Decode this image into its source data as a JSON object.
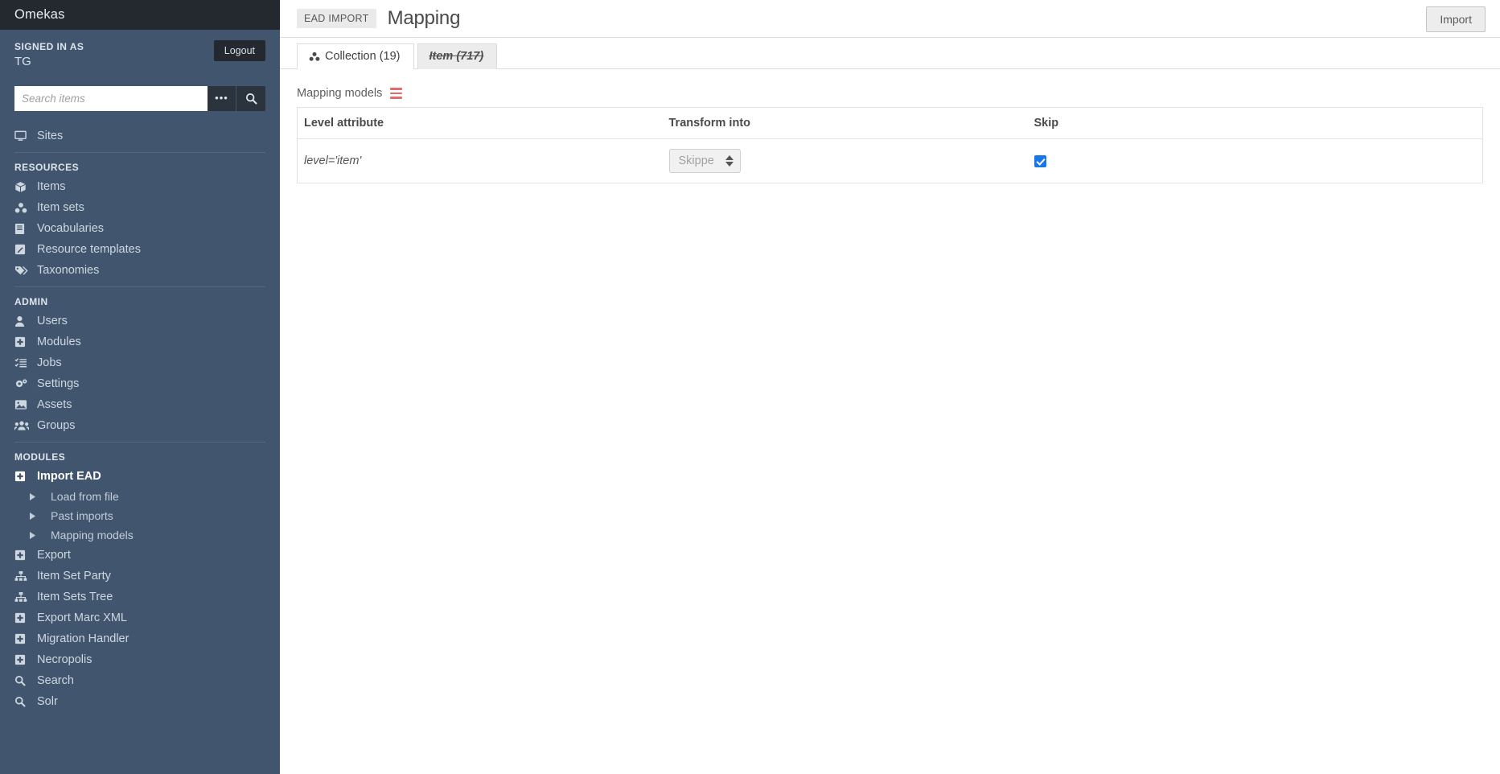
{
  "sidebar": {
    "brand": "Omekas",
    "signed_in_label": "SIGNED IN AS",
    "user": "TG",
    "logout_label": "Logout",
    "search_placeholder": "Search items",
    "search_value": "",
    "top_items": [
      {
        "label": "Sites",
        "icon": "desktop-icon"
      }
    ],
    "sections": [
      {
        "heading": "RESOURCES",
        "items": [
          {
            "label": "Items",
            "icon": "cube-icon"
          },
          {
            "label": "Item sets",
            "icon": "item-sets-icon"
          },
          {
            "label": "Vocabularies",
            "icon": "book-icon"
          },
          {
            "label": "Resource templates",
            "icon": "pencil-square-icon"
          },
          {
            "label": "Taxonomies",
            "icon": "tags-icon"
          }
        ]
      },
      {
        "heading": "ADMIN",
        "items": [
          {
            "label": "Users",
            "icon": "user-icon"
          },
          {
            "label": "Modules",
            "icon": "puzzle-icon"
          },
          {
            "label": "Jobs",
            "icon": "tasks-icon"
          },
          {
            "label": "Settings",
            "icon": "cogs-icon"
          },
          {
            "label": "Assets",
            "icon": "image-icon"
          },
          {
            "label": "Groups",
            "icon": "users-icon"
          }
        ]
      },
      {
        "heading": "MODULES",
        "items": [
          {
            "label": "Import EAD",
            "icon": "puzzle-icon",
            "active": true,
            "children": [
              {
                "label": "Load from file",
                "icon": "caret-right-icon"
              },
              {
                "label": "Past imports",
                "icon": "caret-right-icon"
              },
              {
                "label": "Mapping models",
                "icon": "caret-right-icon"
              }
            ]
          },
          {
            "label": "Export",
            "icon": "puzzle-icon"
          },
          {
            "label": "Item Set Party",
            "icon": "sitemap-icon"
          },
          {
            "label": "Item Sets Tree",
            "icon": "sitemap-icon"
          },
          {
            "label": "Export Marc XML",
            "icon": "puzzle-icon"
          },
          {
            "label": "Migration Handler",
            "icon": "puzzle-icon"
          },
          {
            "label": "Necropolis",
            "icon": "puzzle-icon"
          },
          {
            "label": "Search",
            "icon": "search-icon"
          },
          {
            "label": "Solr",
            "icon": "search-icon"
          }
        ]
      }
    ]
  },
  "header": {
    "breadcrumb": "EAD IMPORT",
    "title": "Mapping",
    "import_label": "Import"
  },
  "tabs": [
    {
      "label": "Collection (19)",
      "icon": "item-sets-icon",
      "active": true,
      "struck": false
    },
    {
      "label": "Item (717)",
      "icon": "",
      "active": false,
      "struck": true
    }
  ],
  "main": {
    "models_label": "Mapping models",
    "table": {
      "columns": [
        "Level attribute",
        "Transform into",
        "Skip"
      ],
      "rows": [
        {
          "level_attribute": "level='item'",
          "transform_into": "Skipped",
          "transform_options": [
            "Skipped"
          ],
          "skip_checked": true
        }
      ]
    }
  },
  "colors": {
    "sidebar_bg": "#41566e",
    "sidebar_brand_bg": "#23292f",
    "accent_red": "#e46b6b",
    "checkbox_blue": "#1877e8"
  }
}
